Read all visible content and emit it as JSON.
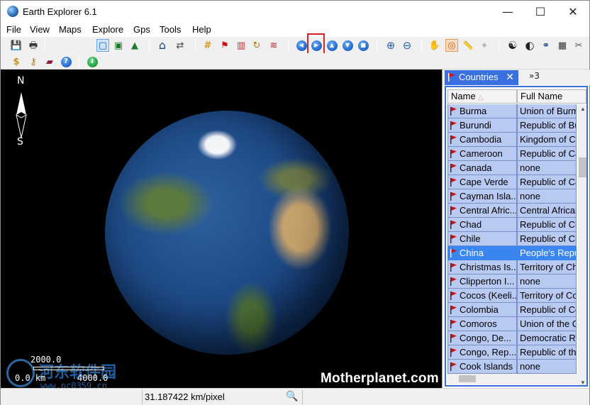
{
  "window": {
    "title": "Earth Explorer 6.1",
    "min_glyph": "—",
    "max_glyph": "☐",
    "close_glyph": "✕"
  },
  "menu": [
    "File",
    "View",
    "Maps",
    "Explore",
    "Gps",
    "Tools",
    "Help"
  ],
  "toolbar": {
    "row1": [
      {
        "name": "save-icon",
        "glyph": "💾"
      },
      {
        "name": "print-icon",
        "glyph": "🖶"
      },
      {
        "name": "view-globe-icon",
        "glyph": "▢"
      },
      {
        "name": "view-map-icon",
        "glyph": "▣"
      },
      {
        "name": "view-terrain-icon",
        "glyph": "▲"
      },
      {
        "name": "home-icon",
        "glyph": "⌂"
      },
      {
        "name": "locate-icon",
        "glyph": "⇄"
      },
      {
        "name": "grid-icon",
        "glyph": "#"
      },
      {
        "name": "flag-icon",
        "glyph": "⚑"
      },
      {
        "name": "chart-icon",
        "glyph": "▥"
      },
      {
        "name": "rotate-icon",
        "glyph": "↻"
      },
      {
        "name": "signal-icon",
        "glyph": "≋"
      },
      {
        "name": "nav-left-icon",
        "glyph": "◀"
      },
      {
        "name": "nav-right-icon",
        "glyph": "▶"
      },
      {
        "name": "nav-up-icon",
        "glyph": "▲"
      },
      {
        "name": "nav-down-icon",
        "glyph": "▼"
      },
      {
        "name": "nav-stop-icon",
        "glyph": "■"
      },
      {
        "name": "zoom-in-icon",
        "glyph": "⊕"
      },
      {
        "name": "zoom-out-icon",
        "glyph": "⊖"
      },
      {
        "name": "hand-icon",
        "glyph": "✋"
      },
      {
        "name": "target-icon",
        "glyph": "◎"
      },
      {
        "name": "ruler-icon",
        "glyph": "📏"
      },
      {
        "name": "gps-icon",
        "glyph": "⌖"
      },
      {
        "name": "yin-yang-icon",
        "glyph": "☯"
      },
      {
        "name": "contrast-icon",
        "glyph": "◐"
      },
      {
        "name": "binoculars-icon",
        "glyph": "⚭"
      },
      {
        "name": "calculator-icon",
        "glyph": "▦"
      },
      {
        "name": "tools-icon",
        "glyph": "✂"
      }
    ],
    "row2": [
      {
        "name": "dollar-icon",
        "glyph": "$"
      },
      {
        "name": "keys-icon",
        "glyph": "⚷"
      },
      {
        "name": "book-icon",
        "glyph": "▰"
      },
      {
        "name": "help-icon",
        "glyph": "?"
      },
      {
        "name": "download-icon",
        "glyph": "⬇"
      }
    ]
  },
  "map": {
    "compass_n": "N",
    "compass_s": "S",
    "brand": "Motherplanet.com",
    "scale": {
      "top": "2000.0",
      "left": "0.0 km",
      "right": "4000.0"
    },
    "watermark": {
      "text": "河东软件园",
      "url": "www.pc0359.cn"
    }
  },
  "panel": {
    "tab_label": "Countries",
    "tab_close": "✕",
    "tab_more": "»3",
    "columns": [
      "Name",
      "Full Name"
    ],
    "sort_glyph": "△",
    "rows": [
      {
        "name": "Burma",
        "full": "Union of Burma",
        "selected": false
      },
      {
        "name": "Burundi",
        "full": "Republic of Burundi",
        "selected": false
      },
      {
        "name": "Cambodia",
        "full": "Kingdom of Cambodia",
        "selected": false
      },
      {
        "name": "Cameroon",
        "full": "Republic of Cameroon",
        "selected": false
      },
      {
        "name": "Canada",
        "full": "none",
        "selected": false
      },
      {
        "name": "Cape Verde",
        "full": "Republic of Cape Verde",
        "selected": false
      },
      {
        "name": "Cayman Isla...",
        "full": "none",
        "selected": false
      },
      {
        "name": "Central Afric...",
        "full": "Central African Republic",
        "selected": false
      },
      {
        "name": "Chad",
        "full": "Republic of Chad",
        "selected": false
      },
      {
        "name": "Chile",
        "full": "Republic of Chile",
        "selected": false
      },
      {
        "name": "China",
        "full": "People's Republic of China",
        "selected": true
      },
      {
        "name": "Christmas Is...",
        "full": "Territory of Christmas Island",
        "selected": false
      },
      {
        "name": "Clipperton I...",
        "full": "none",
        "selected": false
      },
      {
        "name": "Cocos (Keeli...",
        "full": "Territory of Cocos Islands",
        "selected": false
      },
      {
        "name": "Colombia",
        "full": "Republic of Colombia",
        "selected": false
      },
      {
        "name": "Comoros",
        "full": "Union of the Comoros",
        "selected": false
      },
      {
        "name": "Congo, De...",
        "full": "Democratic Republic",
        "selected": false
      },
      {
        "name": "Congo, Rep...",
        "full": "Republic of the Congo",
        "selected": false
      },
      {
        "name": "Cook Islands",
        "full": "none",
        "selected": false
      }
    ]
  },
  "status": {
    "scale_text": "31.187422 km/pixel"
  },
  "colors": {
    "accent": "#3a6fe0",
    "selection": "#3a86f0",
    "row_bg": "#b8c9f2",
    "flag": "#d01010",
    "highlight": "#e02020"
  }
}
